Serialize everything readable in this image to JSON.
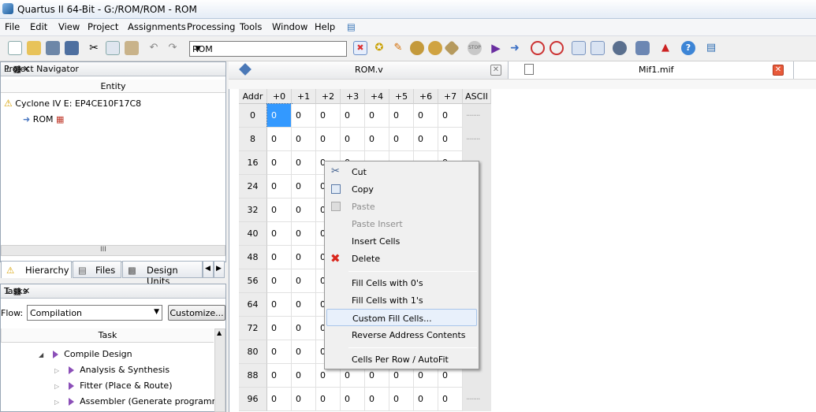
{
  "window": {
    "title": "Quartus II 64-Bit - G:/ROM/ROM - ROM"
  },
  "menu": [
    "File",
    "Edit",
    "View",
    "Project",
    "Assignments",
    "Processing",
    "Tools",
    "Window",
    "Help"
  ],
  "toolbar": {
    "entity_combo": "ROM"
  },
  "navigator": {
    "title": "Project Navigator",
    "column": "Entity",
    "device": "Cyclone IV E: EP4CE10F17C8",
    "top": "ROM",
    "tabs": [
      "Hierarchy",
      "Files",
      "Design Units"
    ],
    "scroll_mark": "III"
  },
  "tasks": {
    "title": "Tasks",
    "flow_label": "Flow:",
    "flow_value": "Compilation",
    "customize": "Customize...",
    "column": "Task",
    "items": [
      "Compile Design",
      "Analysis & Synthesis",
      "Fitter (Place & Route)",
      "Assembler (Generate programming"
    ]
  },
  "doc_tabs": {
    "rom_v": "ROM.v",
    "mif": "Mif1.mif"
  },
  "mif": {
    "addr_header": "Addr",
    "col_headers": [
      "+0",
      "+1",
      "+2",
      "+3",
      "+4",
      "+5",
      "+6",
      "+7"
    ],
    "ascii_header": "ASCII",
    "rows": [
      {
        "addr": "0",
        "cells": [
          "0",
          "0",
          "0",
          "0",
          "0",
          "0",
          "0",
          "0"
        ]
      },
      {
        "addr": "8",
        "cells": [
          "0",
          "0",
          "0",
          "0",
          "0",
          "0",
          "0",
          "0"
        ]
      },
      {
        "addr": "16",
        "cells": [
          "0",
          "0",
          "0",
          "0",
          "",
          "",
          "",
          "0"
        ]
      },
      {
        "addr": "24",
        "cells": [
          "0",
          "0",
          "0",
          "",
          "",
          "",
          "",
          ""
        ]
      },
      {
        "addr": "32",
        "cells": [
          "0",
          "0",
          "0",
          "",
          "",
          "",
          "",
          ""
        ]
      },
      {
        "addr": "40",
        "cells": [
          "0",
          "0",
          "0",
          "",
          "",
          "",
          "",
          ""
        ]
      },
      {
        "addr": "48",
        "cells": [
          "0",
          "0",
          "0",
          "",
          "",
          "",
          "",
          ""
        ]
      },
      {
        "addr": "56",
        "cells": [
          "0",
          "0",
          "0",
          "",
          "",
          "",
          "",
          ""
        ]
      },
      {
        "addr": "64",
        "cells": [
          "0",
          "0",
          "0",
          "",
          "",
          "",
          "",
          ""
        ]
      },
      {
        "addr": "72",
        "cells": [
          "0",
          "0",
          "0",
          "",
          "",
          "",
          "",
          ""
        ]
      },
      {
        "addr": "80",
        "cells": [
          "0",
          "0",
          "0",
          "",
          "",
          "",
          "",
          ""
        ]
      },
      {
        "addr": "88",
        "cells": [
          "0",
          "0",
          "0",
          "0",
          "0",
          "0",
          "0",
          "0"
        ]
      },
      {
        "addr": "96",
        "cells": [
          "0",
          "0",
          "0",
          "0",
          "0",
          "0",
          "0",
          "0"
        ]
      }
    ],
    "ascii_dots": "........"
  },
  "context_menu": {
    "cut": "Cut",
    "copy": "Copy",
    "paste": "Paste",
    "paste_insert": "Paste Insert",
    "insert_cells": "Insert Cells",
    "delete": "Delete",
    "fill0": "Fill Cells with 0's",
    "fill1": "Fill Cells with 1's",
    "custom_fill": "Custom Fill Cells...",
    "reverse": "Reverse Address Contents",
    "cells_per_row": "Cells Per Row / AutoFit"
  },
  "colors": {
    "accent": "#3399ff",
    "highlight": "#e8f0fb",
    "delete_red": "#d9261c",
    "task_triangle": "#8b4fb8"
  }
}
